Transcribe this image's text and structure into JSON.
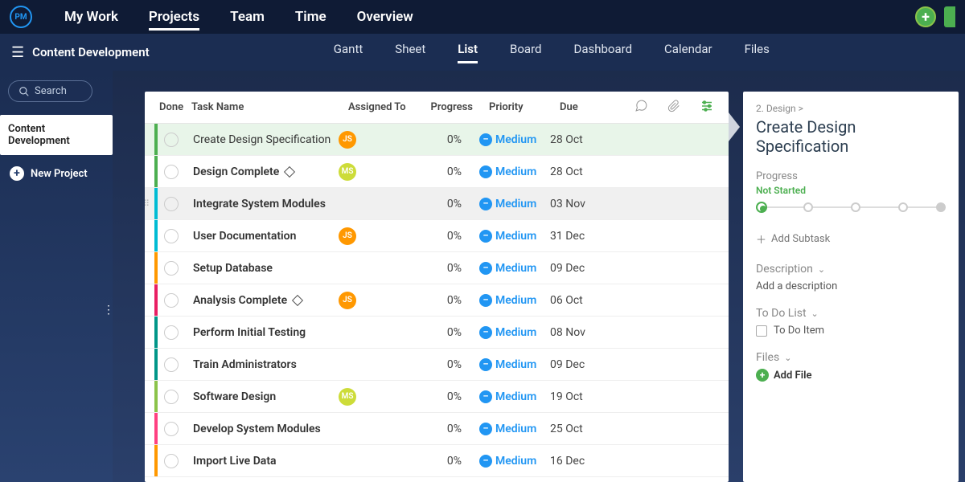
{
  "brand": "PM",
  "topnav": {
    "items": [
      "My Work",
      "Projects",
      "Team",
      "Time",
      "Overview"
    ],
    "active": 1
  },
  "subnav": {
    "title": "Content Development",
    "tabs": [
      "Gantt",
      "Sheet",
      "List",
      "Board",
      "Dashboard",
      "Calendar",
      "Files"
    ],
    "active": 2
  },
  "sidebar": {
    "search": "Search",
    "project": "Content Development",
    "new_project": "New Project"
  },
  "columns": {
    "done": "Done",
    "name": "Task Name",
    "assigned": "Assigned To",
    "progress": "Progress",
    "priority": "Priority",
    "due": "Due"
  },
  "tasks": [
    {
      "name": "Create Design Specification",
      "accent": "accent-green",
      "avatar": "JS",
      "avClass": "av-orange",
      "progress": "0%",
      "priority": "Medium",
      "due": "28 Oct",
      "bold": false,
      "milestone": false,
      "selected": true
    },
    {
      "name": "Design Complete",
      "accent": "accent-green",
      "avatar": "MS",
      "avClass": "av-lime",
      "progress": "0%",
      "priority": "Medium",
      "due": "28 Oct",
      "bold": true,
      "milestone": true,
      "selected": false
    },
    {
      "name": "Integrate System Modules",
      "accent": "accent-cyan",
      "avatar": "",
      "avClass": "",
      "progress": "0%",
      "priority": "Medium",
      "due": "03 Nov",
      "bold": true,
      "milestone": false,
      "selected": false,
      "hover": true
    },
    {
      "name": "User Documentation",
      "accent": "accent-cyan",
      "avatar": "JS",
      "avClass": "av-orange",
      "progress": "0%",
      "priority": "Medium",
      "due": "31 Dec",
      "bold": true,
      "milestone": false,
      "selected": false
    },
    {
      "name": "Setup Database",
      "accent": "accent-orange",
      "avatar": "",
      "avClass": "",
      "progress": "0%",
      "priority": "Medium",
      "due": "09 Dec",
      "bold": true,
      "milestone": false,
      "selected": false
    },
    {
      "name": "Analysis Complete",
      "accent": "accent-magenta",
      "avatar": "JS",
      "avClass": "av-orange",
      "progress": "0%",
      "priority": "Medium",
      "due": "06 Oct",
      "bold": true,
      "milestone": true,
      "selected": false
    },
    {
      "name": "Perform Initial Testing",
      "accent": "accent-teal",
      "avatar": "",
      "avClass": "",
      "progress": "0%",
      "priority": "Medium",
      "due": "08 Nov",
      "bold": true,
      "milestone": false,
      "selected": false
    },
    {
      "name": "Train Administrators",
      "accent": "accent-teal",
      "avatar": "",
      "avClass": "",
      "progress": "0%",
      "priority": "Medium",
      "due": "09 Dec",
      "bold": true,
      "milestone": false,
      "selected": false
    },
    {
      "name": "Software Design",
      "accent": "accent-lime",
      "avatar": "MS",
      "avClass": "av-lime",
      "progress": "0%",
      "priority": "Medium",
      "due": "19 Oct",
      "bold": true,
      "milestone": false,
      "selected": false
    },
    {
      "name": "Develop System Modules",
      "accent": "accent-pink",
      "avatar": "",
      "avClass": "",
      "progress": "0%",
      "priority": "Medium",
      "due": "25 Oct",
      "bold": true,
      "milestone": false,
      "selected": false
    },
    {
      "name": "Import Live Data",
      "accent": "accent-orange",
      "avatar": "",
      "avClass": "",
      "progress": "0%",
      "priority": "Medium",
      "due": "16 Dec",
      "bold": true,
      "milestone": false,
      "selected": false
    }
  ],
  "detail": {
    "crumb": "2. Design >",
    "title": "Create Design Specification",
    "progress_label": "Progress",
    "status": "Not Started",
    "add_subtask": "Add Subtask",
    "desc_label": "Description",
    "desc_placeholder": "Add a description",
    "todo_label": "To Do List",
    "todo_item": "To Do Item",
    "files_label": "Files",
    "add_file": "Add File"
  }
}
